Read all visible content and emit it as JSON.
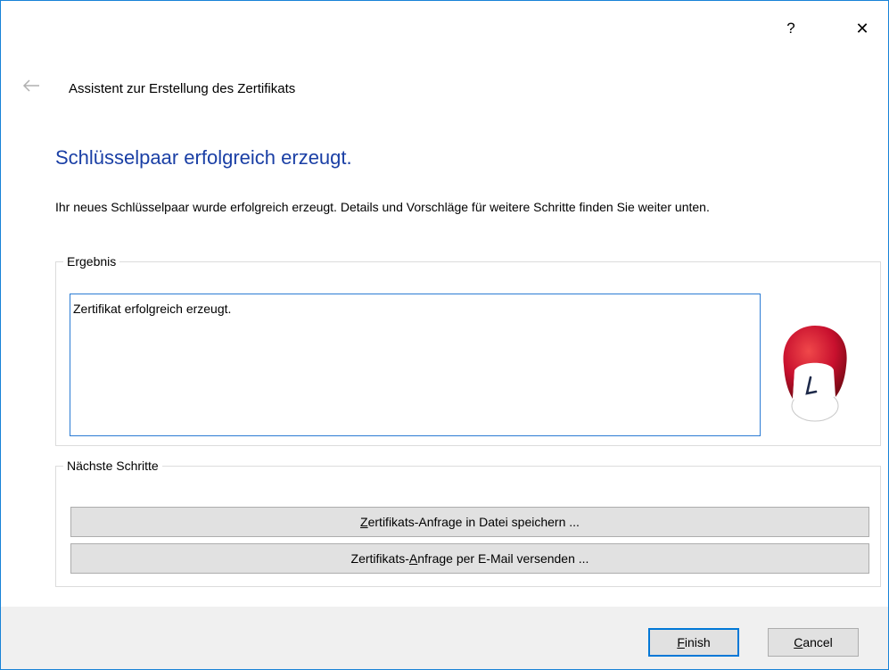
{
  "titlebar": {
    "help_label": "?",
    "close_label": "✕"
  },
  "wizard": {
    "title": "Assistent zur Erstellung des Zertifikats",
    "heading": "Schlüsselpaar erfolgreich erzeugt.",
    "description": "Ihr neues Schlüsselpaar wurde erfolgreich erzeugt. Details und Vorschläge für weitere Schritte finden Sie weiter unten."
  },
  "result": {
    "legend": "Ergebnis",
    "text": "Zertifikat erfolgreich erzeugt."
  },
  "next_steps": {
    "legend": "Nächste Schritte",
    "save_button": {
      "pre": "",
      "mnemonic": "Z",
      "post": "ertifikats-Anfrage in Datei speichern ..."
    },
    "email_button": {
      "pre": "Zertifikats-",
      "mnemonic": "A",
      "post": "nfrage per E-Mail versenden ..."
    }
  },
  "footer": {
    "finish": {
      "mnemonic": "F",
      "rest": "inish"
    },
    "cancel": {
      "mnemonic": "C",
      "rest": "ancel"
    }
  },
  "colors": {
    "accent": "#0078d7",
    "heading": "#1a3fa5",
    "mascot_red": "#c8102e"
  },
  "icons": {
    "back": "arrow-left-icon",
    "mascot": "kleopatra-mascot-icon"
  }
}
